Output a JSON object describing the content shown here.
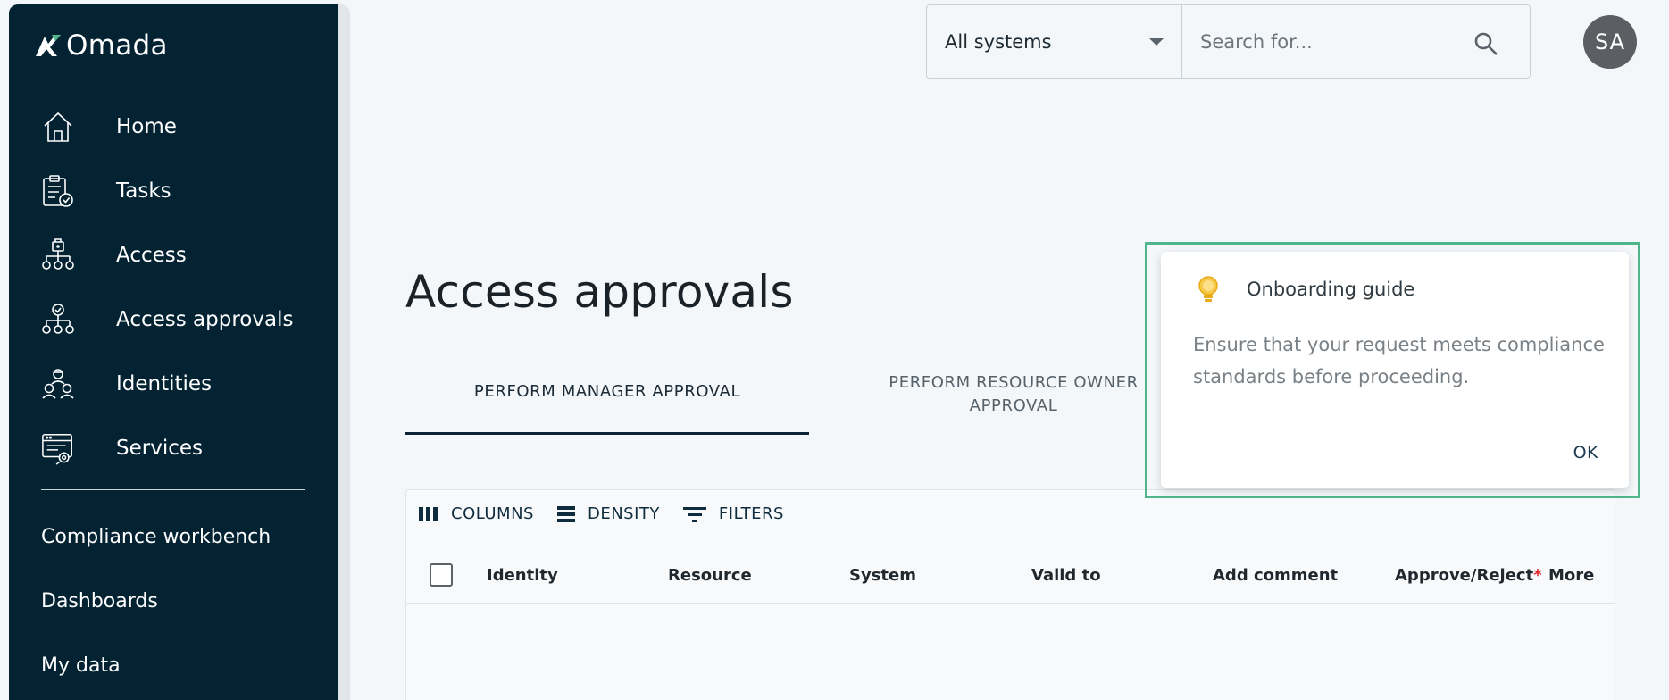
{
  "brand": {
    "name": "Omada"
  },
  "sidebar": {
    "items": [
      {
        "label": "Home",
        "icon": "home-icon"
      },
      {
        "label": "Tasks",
        "icon": "clipboard-check-icon"
      },
      {
        "label": "Access",
        "icon": "access-hierarchy-icon"
      },
      {
        "label": "Access approvals",
        "icon": "approval-hierarchy-icon"
      },
      {
        "label": "Identities",
        "icon": "identities-icon"
      },
      {
        "label": "Services",
        "icon": "services-icon"
      }
    ],
    "links": [
      {
        "label": "Compliance workbench"
      },
      {
        "label": "Dashboards"
      },
      {
        "label": "My data"
      }
    ]
  },
  "topbar": {
    "system_select": "All systems",
    "search_placeholder": "Search for...",
    "avatar_initials": "SA"
  },
  "page": {
    "title": "Access approvals"
  },
  "tabs": [
    {
      "label": "PERFORM MANAGER APPROVAL",
      "active": true
    },
    {
      "label": "PERFORM RESOURCE OWNER APPROVAL",
      "active": false
    }
  ],
  "grid": {
    "toolbar": {
      "columns": "COLUMNS",
      "density": "DENSITY",
      "filters": "FILTERS"
    },
    "columns": [
      "Identity",
      "Resource",
      "System",
      "Valid to",
      "Add comment",
      "Approve/Reject",
      "More"
    ],
    "required_marker": "*"
  },
  "onboarding": {
    "title": "Onboarding guide",
    "body": "Ensure that your request meets compliance standards before proceeding.",
    "ok": "OK",
    "highlight_color": "#4fb58a"
  },
  "colors": {
    "sidebar_bg": "#032333",
    "background": "#f4f7fa",
    "accent": "#0c2433"
  }
}
